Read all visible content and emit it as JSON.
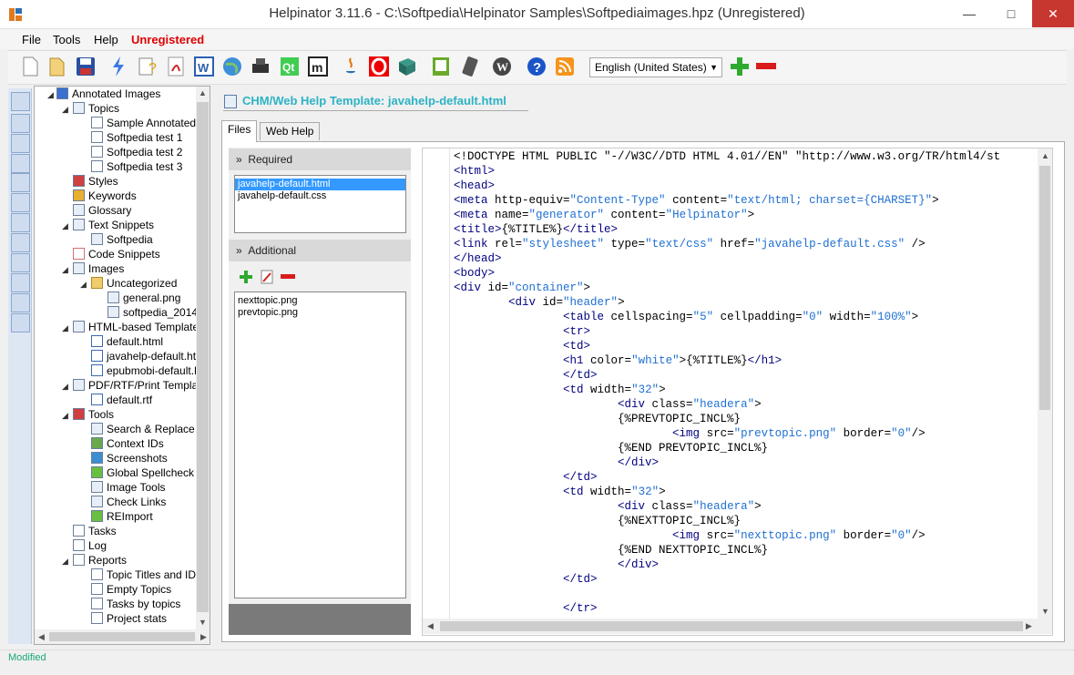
{
  "window": {
    "title": "Helpinator 3.11.6 - C:\\Softpedia\\Helpinator Samples\\Softpediaimages.hpz (Unregistered)"
  },
  "menu": {
    "file": "File",
    "tools": "Tools",
    "help": "Help",
    "unregistered": "Unregistered"
  },
  "toolbar": {
    "language": "English (United States)",
    "icons": [
      "new-document",
      "open-folder",
      "save",
      "lightning",
      "help-question",
      "pdf",
      "word",
      "globe",
      "printer",
      "qt",
      "m-letter",
      "java",
      "opera",
      "book",
      "ebook",
      "mobile",
      "wordpress",
      "help-circle",
      "rss"
    ]
  },
  "tree": {
    "root": "Annotated Images",
    "topics": "Topics",
    "topic_items": [
      "Sample Annotated I",
      "Softpedia test 1",
      "Softpedia test 2",
      "Softpedia test 3"
    ],
    "styles": "Styles",
    "keywords": "Keywords",
    "glossary": "Glossary",
    "text_snippets": "Text Snippets",
    "snippet_item": "Softpedia",
    "code_snippets": "Code Snippets",
    "images": "Images",
    "uncategorized": "Uncategorized",
    "image_items": [
      "general.png",
      "softpedia_2014"
    ],
    "html_templates": "HTML-based Templates",
    "html_items": [
      "default.html",
      "javahelp-default.htm",
      "epubmobi-default.h"
    ],
    "pdf_templates": "PDF/RTF/Print Template",
    "pdf_items": [
      "default.rtf"
    ],
    "tools": "Tools",
    "tool_items": [
      "Search & Replace",
      "Context IDs",
      "Screenshots",
      "Global Spellcheck",
      "Image Tools",
      "Check Links",
      "REImport"
    ],
    "tasks": "Tasks",
    "log": "Log",
    "reports": "Reports",
    "report_items": [
      "Topic Titles and IDs",
      "Empty Topics",
      "Tasks by topics",
      "Project stats"
    ]
  },
  "editor": {
    "template_title": "CHM/Web Help Template: javahelp-default.html",
    "tabs": {
      "files": "Files",
      "web_help": "Web Help"
    },
    "required_label": "Required",
    "required_files": [
      "javahelp-default.html",
      "javahelp-default.css"
    ],
    "additional_label": "Additional",
    "additional_files": [
      "nexttopic.png",
      "prevtopic.png"
    ]
  },
  "status": {
    "text": "Modified"
  },
  "colors": {
    "accent": "#2bb3c4",
    "unregistered": "#e00000",
    "selection": "#3399ff",
    "status": "#1aa87a"
  }
}
